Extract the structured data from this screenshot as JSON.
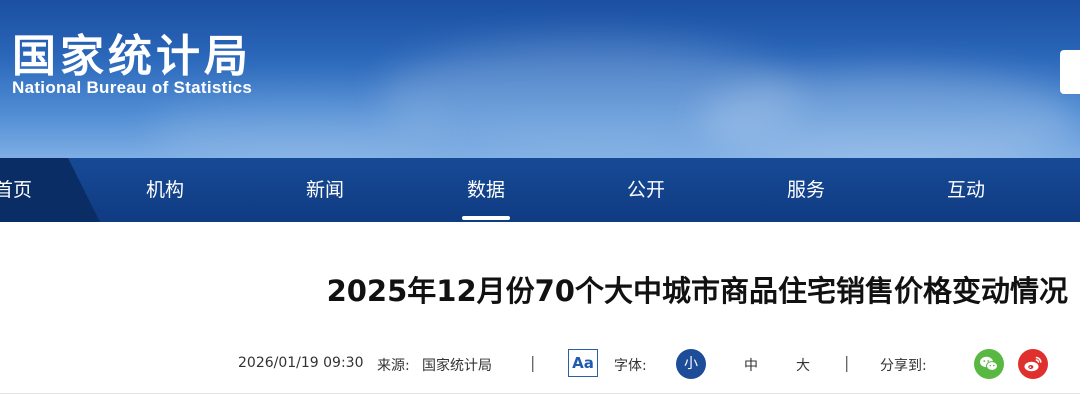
{
  "header": {
    "logo_cn": "国家统计局",
    "logo_en": "National Bureau of Statistics"
  },
  "nav": {
    "items": [
      {
        "label": "首页"
      },
      {
        "label": "机构"
      },
      {
        "label": "新闻"
      },
      {
        "label": "数据"
      },
      {
        "label": "公开"
      },
      {
        "label": "服务"
      },
      {
        "label": "互动"
      }
    ],
    "active_label": "数据"
  },
  "article": {
    "title": "2025年12月份70个大中城市商品住宅销售价格变动情况",
    "date": "2026/01/19 09:30",
    "source_label": "来源:",
    "source": "国家统计局",
    "font_size_button": "Aa",
    "font_label": "字体:",
    "font_sizes": [
      "小",
      "中",
      "大"
    ],
    "share_label": "分享到:",
    "share_targets": [
      "wechat-icon",
      "weibo-icon"
    ]
  },
  "colors": {
    "nav_bg": "#0f3b82",
    "active_size": "#1d4c99",
    "wechat": "#59b842",
    "weibo": "#e0302e"
  }
}
